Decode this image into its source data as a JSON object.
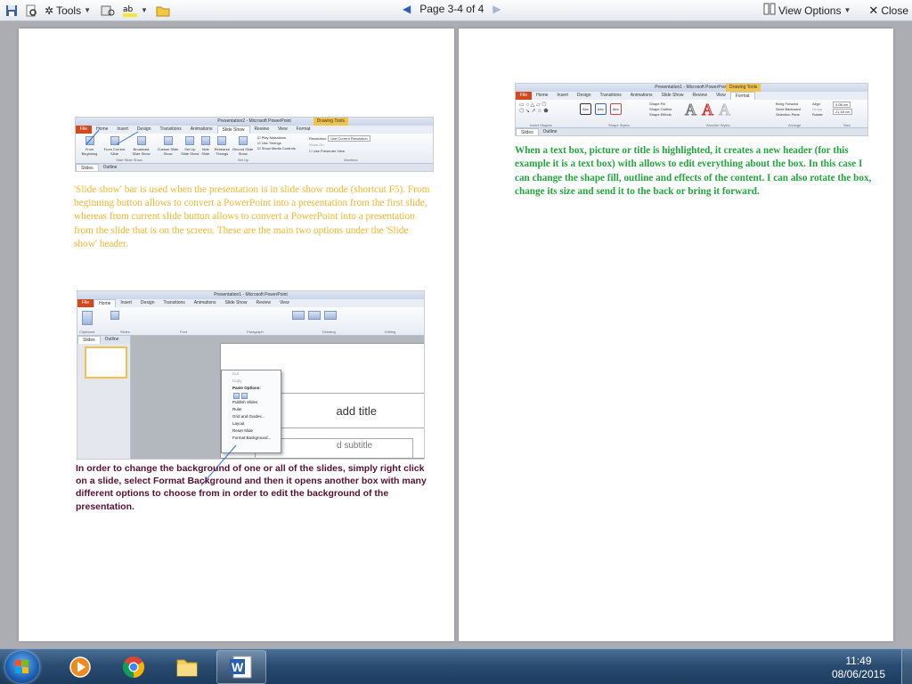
{
  "toolbar": {
    "tools_label": "Tools",
    "page_label": "Page 3-4 of 4",
    "view_options_label": "View Options",
    "close_label": "Close"
  },
  "page1": {
    "shot1": {
      "title": "Presentation2 - Microsoft PowerPoint",
      "contextual_tab": "Drawing Tools",
      "tabs": [
        "File",
        "Home",
        "Insert",
        "Design",
        "Transitions",
        "Animations",
        "Slide Show",
        "Review",
        "View",
        "Format"
      ],
      "buttons": [
        "From Beginning",
        "From Current Slide",
        "Broadcast Slide Show",
        "Custom Slide Show",
        "Set Up Slide Show",
        "Hide Slide",
        "Rehearse Timings",
        "Record Slide Show"
      ],
      "checks": [
        "Play Narrations",
        "Use Timings",
        "Show Media Controls"
      ],
      "monitors": [
        "Resolution:",
        "Use Current Resolution",
        "Show On:",
        "Use Presenter View"
      ],
      "groups": [
        "Start Slide Show",
        "Set Up",
        "Monitors"
      ],
      "pane_tabs": [
        "Slides",
        "Outline"
      ]
    },
    "paragraph1": "'Slide show' bar is used when the presentation is in slide show mode (shortcut F5). From beginning button allows to convert a PowerPoint into a presentation from the first slide, whereas from current slide button allows to convert a PowerPoint into a presentation from the slide that is on the screen. These are the main two options under the 'Slide show' header.",
    "shot2": {
      "title": "Presentation1 - Microsoft PowerPoint",
      "tabs": [
        "File",
        "Home",
        "Insert",
        "Design",
        "Transitions",
        "Animations",
        "Slide Show",
        "Review",
        "View"
      ],
      "groups": [
        "Clipboard",
        "Slides",
        "Font",
        "Paragraph",
        "Drawing",
        "Editing"
      ],
      "pane_tabs": [
        "Slides",
        "Outline"
      ],
      "slide_title": "add title",
      "slide_subtitle": "d subtitle",
      "context_menu": [
        "Cut",
        "Copy",
        "Paste Options:",
        "Publish Slides",
        "Ruler",
        "Grid and Guides...",
        "Layout",
        "Reset Slide",
        "Format Background..."
      ]
    },
    "paragraph2": "In order to change the background of one or all of the slides, simply right click on a slide, select Format Background and then it opens another box with many different options to choose from in order to edit the background of the presentation."
  },
  "page2": {
    "shot3": {
      "title": "Presentation1 - Microsoft PowerPoint",
      "contextual_tab": "Drawing Tools",
      "tabs": [
        "File",
        "Home",
        "Insert",
        "Design",
        "Transitions",
        "Animations",
        "Slide Show",
        "Review",
        "View",
        "Format"
      ],
      "groups": [
        "Insert Shapes",
        "Shape Styles",
        "WordArt Styles",
        "Arrange",
        "Size"
      ],
      "shape_items": [
        "Shape Fill",
        "Shape Outline",
        "Shape Effects"
      ],
      "arrange_items": [
        "Bring Forward",
        "Send Backward",
        "Selection Pane",
        "Align",
        "Group",
        "Rotate"
      ],
      "size_height": "4.08 cm",
      "size_width": "21.59 cm",
      "style_label": "Abc",
      "pane_tabs": [
        "Slides",
        "Outline"
      ]
    },
    "paragraph": "When a text box, picture or title is highlighted, it creates a new header (for this example it is a text box) with allows to edit everything about the box. In this case I can change the shape fill, outline and effects of the content. I can also rotate the box, change its size and send it to the back or bring it forward."
  },
  "taskbar": {
    "time": "11:49",
    "date": "08/06/2015"
  },
  "colors": {
    "orange_text": "#f2b630",
    "maroon_text": "#5a1030",
    "green_text": "#24a53f"
  }
}
